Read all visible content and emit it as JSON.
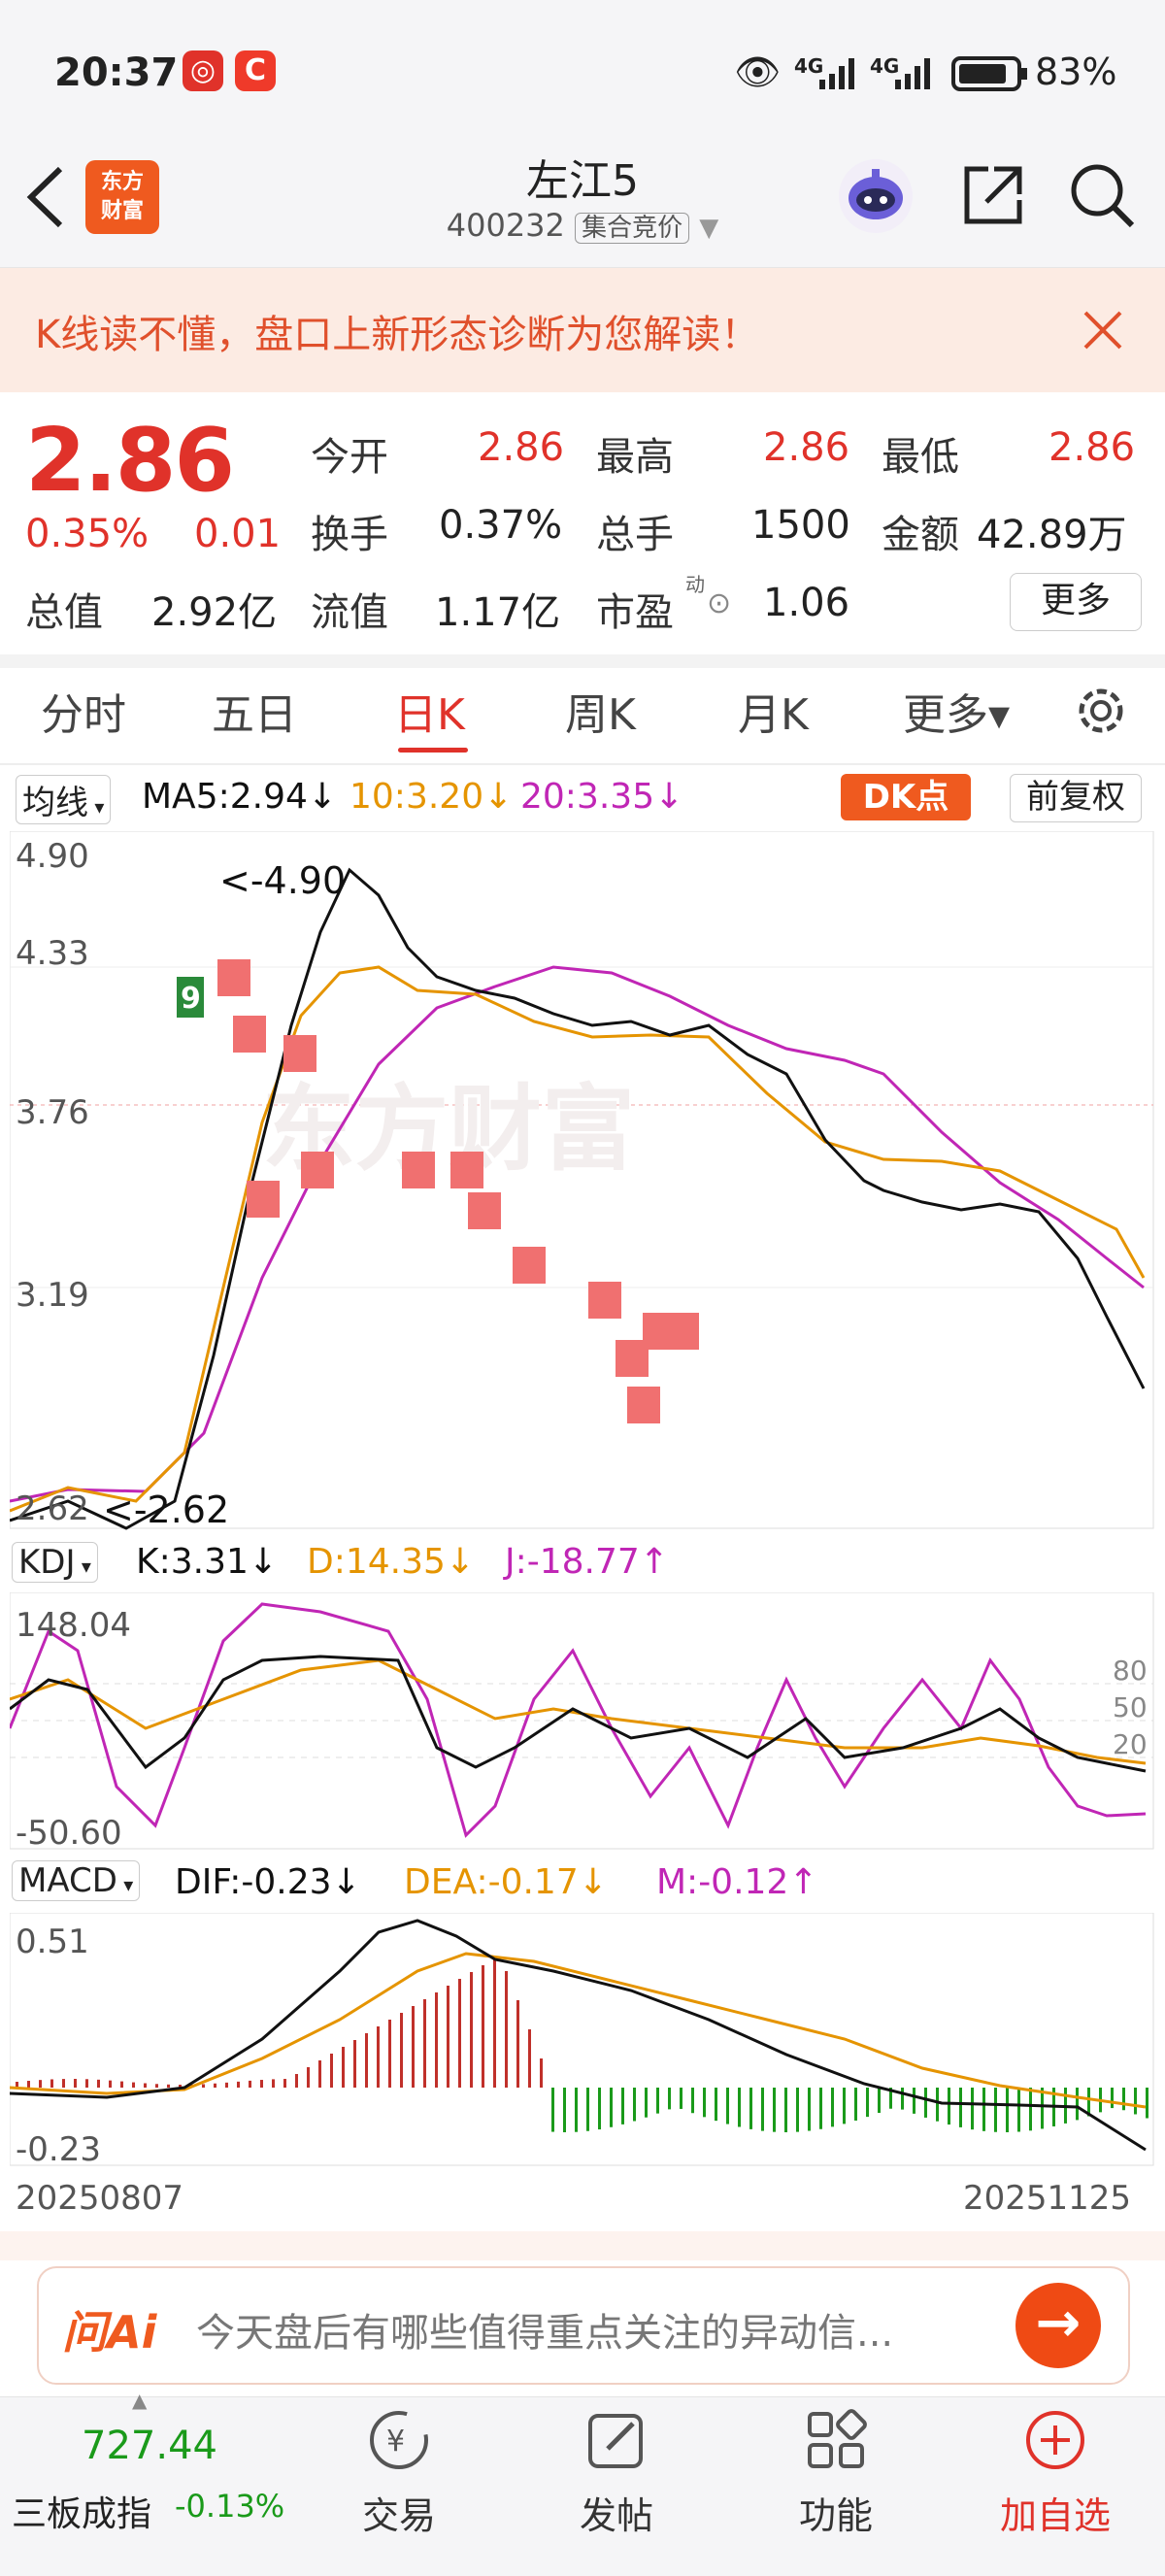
{
  "status": {
    "time": "20:37",
    "net1": "4G",
    "net2": "4G",
    "battery": "83%"
  },
  "header": {
    "logo_line1": "东方",
    "logo_line2": "财富",
    "title": "左江5",
    "code": "400232",
    "session": "集合竞价"
  },
  "promo": {
    "text": "K线读不懂，盘口上新形态诊断为您解读！"
  },
  "quote": {
    "price": "2.86",
    "change_pct": "0.35%",
    "change": "0.01",
    "open_label": "今开",
    "open": "2.86",
    "high_label": "最高",
    "high": "2.86",
    "low_label": "最低",
    "low": "2.86",
    "turnover_label": "换手",
    "turnover": "0.37%",
    "volume_label": "总手",
    "volume": "1500",
    "amount_label": "金额",
    "amount": "42.89万",
    "mcap_label": "总值",
    "mcap": "2.92亿",
    "float_label": "流值",
    "float": "1.17亿",
    "pe_label": "市盈",
    "pe_sup": "动",
    "pe": "1.06",
    "more": "更多"
  },
  "tabs": [
    "分时",
    "五日",
    "日K",
    "周K",
    "月K",
    "更多▾"
  ],
  "active_tab": "日K",
  "chart": {
    "ma_selector": "均线",
    "ma5": "MA5:2.94↓",
    "ma10": "10:3.20↓",
    "ma20": "20:3.35↓",
    "dk_button": "DK点",
    "adjust_button": "前复权",
    "y_labels": [
      "4.90",
      "4.33",
      "3.76",
      "3.19",
      "2.62"
    ],
    "high_annot": "<-4.90",
    "low_annot": "<-2.62",
    "kdj_selector": "KDJ",
    "kdj_k": "K:3.31↓",
    "kdj_d": "D:14.35↓",
    "kdj_j": "J:-18.77↑",
    "kdj_y_top": "148.04",
    "kdj_y_bottom": "-50.60",
    "kdj_levels": [
      "80",
      "50",
      "20"
    ],
    "macd_selector": "MACD",
    "macd_dif": "DIF:-0.23↓",
    "macd_dea": "DEA:-0.17↓",
    "macd_m": "M:-0.12↑",
    "macd_y_top": "0.51",
    "macd_y_bottom": "-0.23",
    "date_start": "20250807",
    "date_end": "20251125",
    "colors": {
      "ma5": "#111111",
      "ma10": "#e59400",
      "ma20": "#c026b5",
      "up": "#e0322a",
      "down": "#1a9a1a"
    }
  },
  "ai": {
    "logo": "问Ai",
    "placeholder": "今天盘后有哪些值得重点关注的异动信..."
  },
  "bottom_nav": {
    "index_value": "727.44",
    "index_name": "三板成指",
    "index_change": "-0.13%",
    "items": [
      "交易",
      "发帖",
      "功能",
      "加自选"
    ]
  }
}
